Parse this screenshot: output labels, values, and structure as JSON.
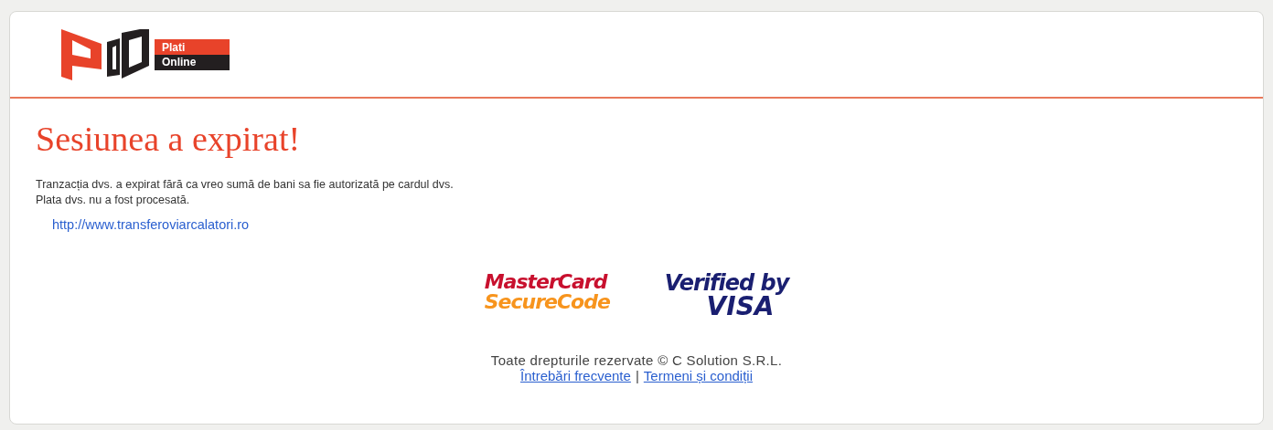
{
  "logo": {
    "line_1": "Plati",
    "line_2": "Online"
  },
  "title": "Sesiunea a expirat!",
  "message": [
    "Tranzacția dvs. a expirat fără ca vreo sumă de bani sa fie autorizată pe cardul dvs.",
    "Plata dvs. nu a fost procesată."
  ],
  "return_link": "http://www.transferoviarcalatori.ro",
  "badges": [
    {
      "kind": "mastercard",
      "line_1": "MasterCard",
      "line_2": "SecureCode"
    },
    {
      "kind": "visa",
      "line_1": "Verified by",
      "line_2": "VISA"
    }
  ],
  "footer": {
    "copyright": "Toate drepturile rezervate © C Solution S.R.L.",
    "links": [
      "Întrebări frecvente",
      "Termeni și condiții"
    ],
    "separator": "|"
  }
}
